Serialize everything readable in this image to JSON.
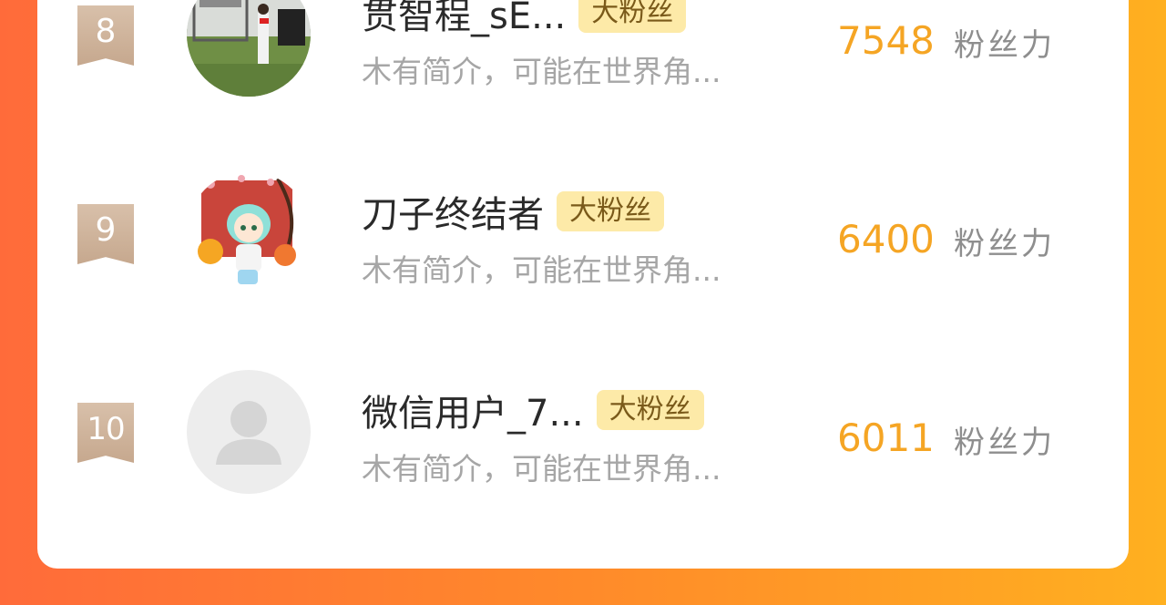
{
  "rows": [
    {
      "rank": "8",
      "name": "贯智程_sE...",
      "badge": "大粉丝",
      "bio": "木有简介，可能在世界角...",
      "score": "7548",
      "score_label": "粉丝力",
      "avatar": "photo"
    },
    {
      "rank": "9",
      "name": "刀子终结者",
      "badge": "大粉丝",
      "bio": "木有简介，可能在世界角...",
      "score": "6400",
      "score_label": "粉丝力",
      "avatar": "illustration"
    },
    {
      "rank": "10",
      "name": "微信用户_7...",
      "badge": "大粉丝",
      "bio": "木有简介，可能在世界角...",
      "score": "6011",
      "score_label": "粉丝力",
      "avatar": "default-user-icon"
    }
  ],
  "colors": {
    "accent_score": "#f5a524",
    "badge_bg": "#fdeaa8",
    "rank_ribbon": "#c6a88e",
    "background_gradient": [
      "#ff6b3a",
      "#ffb020"
    ]
  }
}
